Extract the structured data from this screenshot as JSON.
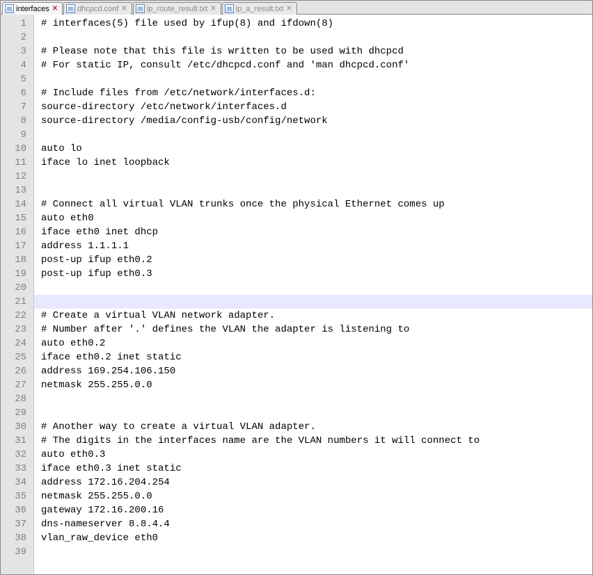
{
  "tabs": [
    {
      "label": "interfaces",
      "active": true
    },
    {
      "label": "dhcpcd.conf",
      "active": false
    },
    {
      "label": "ip_route_result.txt",
      "active": false
    },
    {
      "label": "ip_a_result.txt",
      "active": false
    }
  ],
  "current_line": 21,
  "lines": [
    "# interfaces(5) file used by ifup(8) and ifdown(8)",
    "",
    "# Please note that this file is written to be used with dhcpcd",
    "# For static IP, consult /etc/dhcpcd.conf and 'man dhcpcd.conf'",
    "",
    "# Include files from /etc/network/interfaces.d:",
    "source-directory /etc/network/interfaces.d",
    "source-directory /media/config-usb/config/network",
    "",
    "auto lo",
    "iface lo inet loopback",
    "",
    "",
    "# Connect all virtual VLAN trunks once the physical Ethernet comes up",
    "auto eth0",
    "iface eth0 inet dhcp",
    "address 1.1.1.1",
    "post-up ifup eth0.2",
    "post-up ifup eth0.3",
    "",
    "",
    "# Create a virtual VLAN network adapter.",
    "# Number after '.' defines the VLAN the adapter is listening to",
    "auto eth0.2",
    "iface eth0.2 inet static",
    "address 169.254.106.150",
    "netmask 255.255.0.0",
    "",
    "",
    "# Another way to create a virtual VLAN adapter.",
    "# The digits in the interfaces name are the VLAN numbers it will connect to",
    "auto eth0.3",
    "iface eth0.3 inet static",
    "address 172.16.204.254",
    "netmask 255.255.0.0",
    "gateway 172.16.200.16",
    "dns-nameserver 8.8.4.4",
    "vlan_raw_device eth0",
    ""
  ]
}
